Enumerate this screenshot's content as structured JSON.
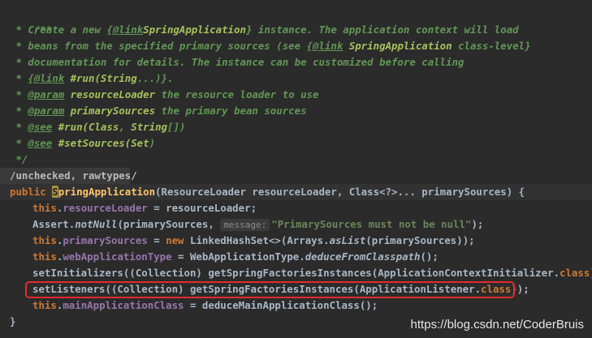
{
  "code": {
    "javadoc": {
      "open": "/**",
      "l1a": " * Create a new ",
      "l1_link": "{@link",
      "l1_ref": "SpringApplication",
      "l1b": "} instance. The application context will load",
      "l2a": " * beans from the specified primary sources (see ",
      "l2_link": "{@link",
      "l2_ref": "SpringApplication",
      "l2b": " class-level}",
      "l3": " * documentation for details. The instance can be customized before calling",
      "l4a": " * ",
      "l4_link": "{@link",
      "l4_ref": " #run(",
      "l4_type": "String",
      "l4b": "...)}.",
      "l5a": " * ",
      "l5_tag": "@param",
      "l5_param": " resourceLoader",
      "l5b": " the resource loader to use",
      "l6a": " * ",
      "l6_tag": "@param",
      "l6_param": " primarySources",
      "l6b": " the primary bean sources",
      "l7a": " * ",
      "l7_tag": "@see",
      "l7_ref": " #run(",
      "l7_t1": "Class",
      "l7_c": ", ",
      "l7_t2": "String",
      "l7b": "[])",
      "l8a": " * ",
      "l8_tag": "@see",
      "l8_ref": " #setSources(",
      "l8_t": "Set",
      "l8b": ")",
      "close": " */"
    },
    "annotation": "/unchecked, rawtypes/",
    "signature": {
      "kw": "public ",
      "caret_char": "S",
      "name_rest": "pringApplication",
      "params": "(ResourceLoader resourceLoader, Class<?>... primarySources) {"
    },
    "body": {
      "b1_this": "this",
      "b1_dot": ".",
      "b1_field": "resourceLoader",
      "b1_rest": " = resourceLoader;",
      "b2_a": "Assert.",
      "b2_method": "notNull",
      "b2_b": "(primarySources, ",
      "b2_hint": "message:",
      "b2_str": "\"PrimarySources must not be null\"",
      "b2_c": ");",
      "b3_this": "this",
      "b3_dot": ".",
      "b3_field": "primarySources",
      "b3_eq": " = ",
      "b3_new": "new",
      "b3_a": " LinkedHashSet<>(Arrays.",
      "b3_method": "asList",
      "b3_b": "(primarySources));",
      "b4_this": "this",
      "b4_dot": ".",
      "b4_field": "webApplicationType",
      "b4_a": " = WebApplicationType.",
      "b4_method": "deduceFromClasspath",
      "b4_b": "();",
      "b5_a": "setInitializers((Collection) getSpringFactoriesInstances(ApplicationContextInitializer.",
      "b5_kw": "class",
      "b5_b": "));",
      "b6_a": "setListeners((Collection) getSpringFactoriesInstances(ApplicationListener.",
      "b6_kw": "class",
      "b6_b": "));",
      "b7_this": "this",
      "b7_dot": ".",
      "b7_field": "mainApplicationClass",
      "b7_rest": " = deduceMainApplicationClass();",
      "close": "}"
    }
  },
  "watermark": "https://blog.csdn.net/CoderBruis",
  "colors": {
    "background": "#2b2b2b",
    "javadoc": "#629755",
    "keyword": "#cc7832",
    "field": "#9876aa",
    "string": "#6a8759",
    "highlight_box": "#e22b2b"
  }
}
